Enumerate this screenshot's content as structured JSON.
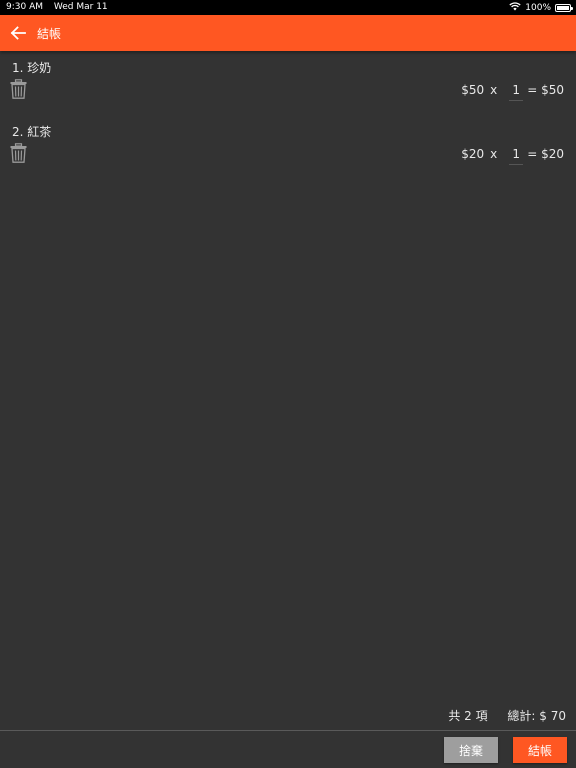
{
  "status_bar": {
    "time": "9:30 AM",
    "date": "Wed Mar 11",
    "battery": "100%",
    "battery_level": 1.0
  },
  "app_bar": {
    "title": "結帳",
    "back_icon": "arrow-left-icon"
  },
  "cart": {
    "items": [
      {
        "name": "1. 珍奶",
        "price": "$50",
        "times": "x",
        "qty": "1",
        "subtotal": "= $50"
      },
      {
        "name": "2. 紅茶",
        "price": "$20",
        "times": "x",
        "qty": "1",
        "subtotal": "= $20"
      }
    ],
    "delete_icon": "trash-icon"
  },
  "summary": {
    "count": "共 2 項",
    "total": "總計: $ 70"
  },
  "actions": {
    "discard_label": "捨棄",
    "checkout_label": "結帳"
  },
  "colors": {
    "accent": "#ff5722",
    "background": "#333333",
    "discard": "#9e9e9e"
  }
}
